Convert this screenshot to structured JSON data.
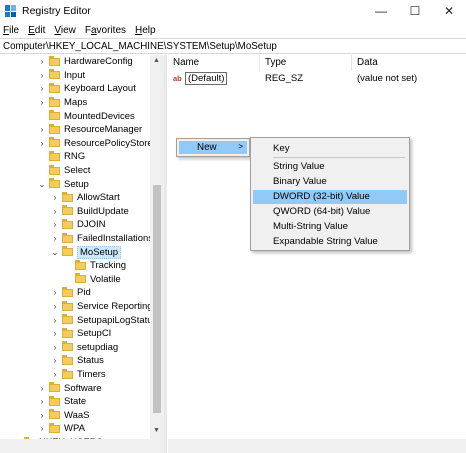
{
  "window": {
    "title": "Registry Editor",
    "minimize_glyph": "—",
    "maximize_glyph": "☐",
    "close_glyph": "✕"
  },
  "menubar": [
    {
      "label": "File",
      "key": "F"
    },
    {
      "label": "Edit",
      "key": "E"
    },
    {
      "label": "View",
      "key": "V"
    },
    {
      "label": "Favorites",
      "key": "a"
    },
    {
      "label": "Help",
      "key": "H"
    }
  ],
  "address": "Computer\\HKEY_LOCAL_MACHINE\\SYSTEM\\Setup\\MoSetup",
  "tree": {
    "items": [
      {
        "label": "HardwareConfig",
        "expand": "collapsed"
      },
      {
        "label": "Input",
        "expand": "collapsed"
      },
      {
        "label": "Keyboard Layout",
        "expand": "collapsed"
      },
      {
        "label": "Maps",
        "expand": "collapsed"
      },
      {
        "label": "MountedDevices",
        "expand": "none"
      },
      {
        "label": "ResourceManager",
        "expand": "collapsed"
      },
      {
        "label": "ResourcePolicyStore",
        "expand": "collapsed"
      },
      {
        "label": "RNG",
        "expand": "none"
      },
      {
        "label": "Select",
        "expand": "none"
      },
      {
        "label": "Setup",
        "expand": "expanded"
      },
      {
        "label": "AllowStart",
        "expand": "collapsed"
      },
      {
        "label": "BuildUpdate",
        "expand": "collapsed"
      },
      {
        "label": "DJOIN",
        "expand": "collapsed"
      },
      {
        "label": "FailedInstallations",
        "expand": "collapsed"
      },
      {
        "label": "MoSetup",
        "expand": "expanded",
        "selected": true
      },
      {
        "label": "Tracking",
        "expand": "none"
      },
      {
        "label": "Volatile",
        "expand": "none"
      },
      {
        "label": "Pid",
        "expand": "collapsed"
      },
      {
        "label": "Service Reporting A",
        "expand": "collapsed"
      },
      {
        "label": "SetupapiLogStatus",
        "expand": "collapsed"
      },
      {
        "label": "SetupCI",
        "expand": "collapsed"
      },
      {
        "label": "setupdiag",
        "expand": "collapsed"
      },
      {
        "label": "Status",
        "expand": "collapsed"
      },
      {
        "label": "Timers",
        "expand": "collapsed"
      },
      {
        "label": "Software",
        "expand": "collapsed"
      },
      {
        "label": "State",
        "expand": "collapsed"
      },
      {
        "label": "WaaS",
        "expand": "collapsed"
      },
      {
        "label": "WPA",
        "expand": "collapsed"
      },
      {
        "label": "HKEY_USERS",
        "expand": "collapsed"
      }
    ]
  },
  "values_pane": {
    "columns": [
      "Name",
      "Type",
      "Data"
    ],
    "rows": [
      {
        "name": "(Default)",
        "type": "REG_SZ",
        "data": "(value not set)",
        "icon": "ab"
      }
    ]
  },
  "context_menu": {
    "new_label": "New",
    "new_arrow": ">",
    "submenu": [
      {
        "label": "Key",
        "highlight": false
      },
      {
        "label": "String Value",
        "highlight": false
      },
      {
        "label": "Binary Value",
        "highlight": false
      },
      {
        "label": "DWORD (32-bit) Value",
        "highlight": true
      },
      {
        "label": "QWORD (64-bit) Value",
        "highlight": false
      },
      {
        "label": "Multi-String Value",
        "highlight": false
      },
      {
        "label": "Expandable String Value",
        "highlight": false
      }
    ]
  },
  "colors": {
    "highlight": "#91c9f7",
    "menu_bg": "#f0f0f0",
    "folder": "#f3cc5b",
    "app_icon": "#1e78c8"
  }
}
